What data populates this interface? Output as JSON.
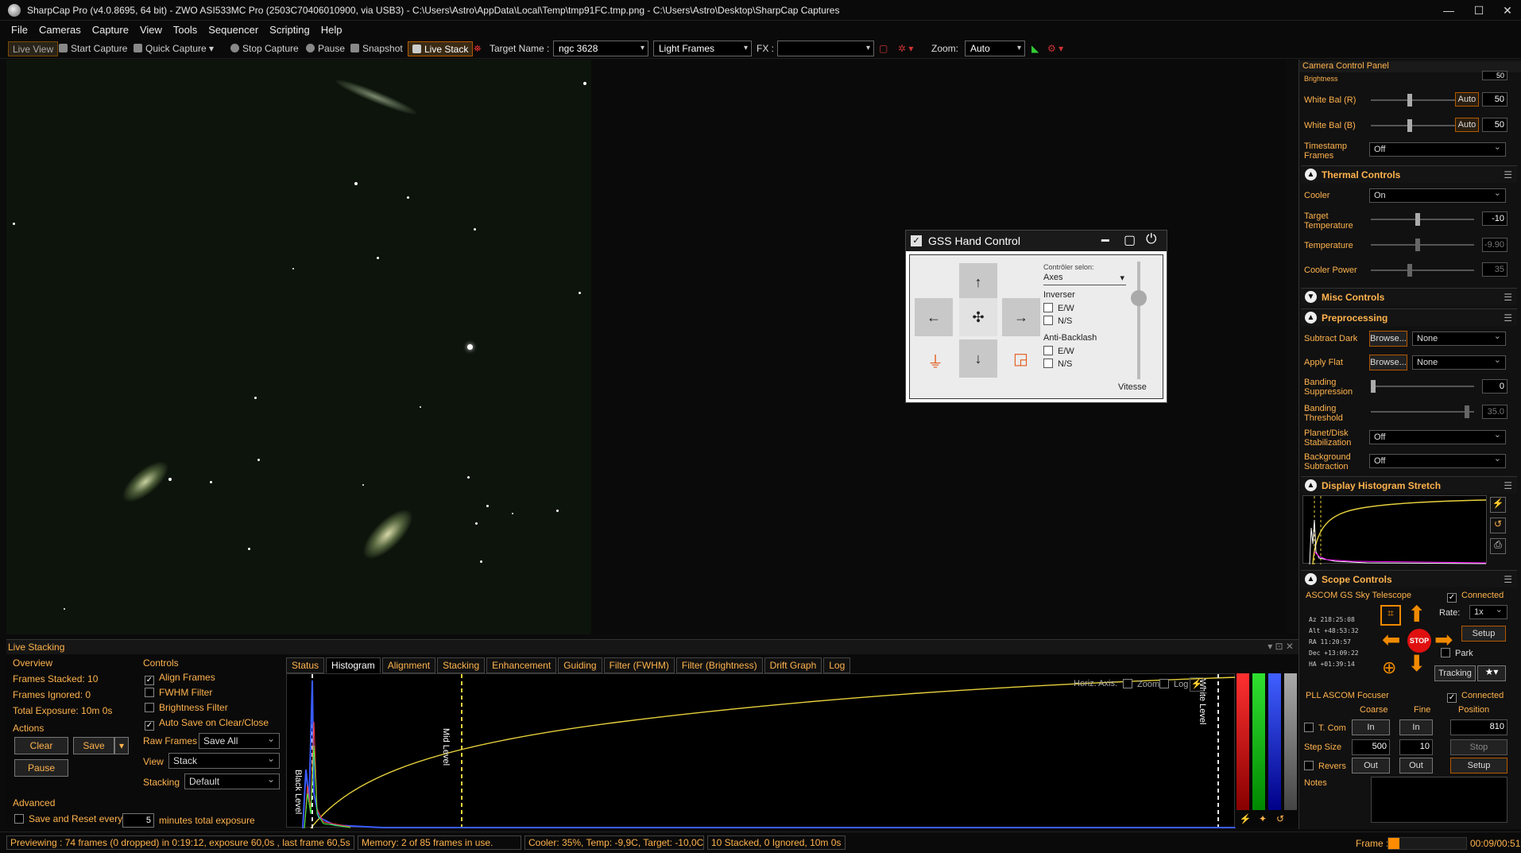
{
  "window": {
    "title": "SharpCap Pro (v4.0.8695, 64 bit) - ZWO ASI533MC Pro (2503C70406010900, via USB3) - C:\\Users\\Astro\\AppData\\Local\\Temp\\tmp91FC.tmp.png - C:\\Users\\Astro\\Desktop\\SharpCap Captures",
    "minimize": "—",
    "maximize": "☐",
    "close": "✕"
  },
  "menu": [
    "File",
    "Cameras",
    "Capture",
    "View",
    "Tools",
    "Sequencer",
    "Scripting",
    "Help"
  ],
  "toolbar": {
    "live_view": "Live View",
    "start_capture": "Start Capture",
    "quick_capture": "Quick Capture",
    "stop_capture": "Stop Capture",
    "pause": "Pause",
    "snapshot": "Snapshot",
    "live_stack": "Live Stack",
    "target_label": "Target Name :",
    "target_value": "ngc 3628",
    "frame_type": "Light Frames",
    "fx_label": "FX :",
    "fx_value": "",
    "zoom_label": "Zoom:",
    "zoom_value": "Auto"
  },
  "gss": {
    "title": "GSS Hand Control",
    "controller_label": "Contrôler selon:",
    "controller_value": "Axes",
    "invert_label": "Inverser",
    "ew": "E/W",
    "ns": "N/S",
    "backlash_label": "Anti-Backlash",
    "ew2": "E/W",
    "ns2": "N/S",
    "speed": "Vitesse",
    "up": "↑",
    "down": "↓",
    "left": "←",
    "right": "→",
    "center": "✣"
  },
  "camera_panel": {
    "title": "Camera Control Panel",
    "brightness_label": "Brightness",
    "brightness_value": "50",
    "wb_r_label": "White Bal (R)",
    "wb_r_auto": "Auto",
    "wb_r_value": "50",
    "wb_b_label": "White Bal (B)",
    "wb_b_auto": "Auto",
    "wb_b_value": "50",
    "timestamp_label": "Timestamp Frames",
    "timestamp_value": "Off",
    "thermal_title": "Thermal Controls",
    "cooler_label": "Cooler",
    "cooler_value": "On",
    "target_temp_label": "Target Temperature",
    "target_temp_value": "-10",
    "temp_label": "Temperature",
    "temp_value": "-9.90",
    "cooler_power_label": "Cooler Power",
    "cooler_power_value": "35",
    "misc_title": "Misc Controls",
    "pre_title": "Preprocessing",
    "subtract_dark_label": "Subtract Dark",
    "browse1": "Browse...",
    "dark_value": "None",
    "apply_flat_label": "Apply Flat",
    "browse2": "Browse...",
    "flat_value": "None",
    "banding_sup_label": "Banding Suppression",
    "banding_sup_value": "0",
    "banding_thr_label": "Banding Threshold",
    "banding_thr_value": "35.0",
    "planet_label": "Planet/Disk Stabilization",
    "planet_value": "Off",
    "bg_label": "Background Subtraction",
    "bg_value": "Off",
    "hist_title": "Display Histogram Stretch",
    "scope_title": "Scope Controls",
    "scope_name": "ASCOM GS Sky Telescope",
    "connected1": "Connected",
    "coords": [
      "Az   218:25:08",
      "Alt  +48:53:32",
      "RA    11:20:57",
      "Dec  +13:09:22",
      "HA   +01:39:14"
    ],
    "rate_label": "Rate:",
    "rate_value": "1x",
    "setup1": "Setup",
    "park": "Park",
    "tracking": "Tracking",
    "stop": "STOP",
    "focuser_name": "PLL ASCOM Focuser",
    "connected2": "Connected",
    "coarse": "Coarse",
    "fine": "Fine",
    "position": "Position",
    "tcomp": "T. Com",
    "in1": "In",
    "in2": "In",
    "pos_value": "810",
    "step_label": "Step Size",
    "step_coarse": "500",
    "step_fine": "10",
    "stop_btn": "Stop",
    "reverse": "Revers",
    "out1": "Out",
    "out2": "Out",
    "setup2": "Setup",
    "notes_label": "Notes"
  },
  "livestack": {
    "title": "Live Stacking",
    "overview": "Overview",
    "frames_stacked": "Frames Stacked:  10",
    "frames_ignored": "Frames Ignored:  0",
    "total_exposure": "Total Exposure:   10m 0s",
    "actions": "Actions",
    "clear": "Clear",
    "save": "Save",
    "pause": "Pause",
    "controls": "Controls",
    "align": "Align Frames",
    "fwhm": "FWHM Filter",
    "brightness": "Brightness Filter",
    "autosave": "Auto Save on Clear/Close",
    "raw_frames_label": "Raw Frames",
    "raw_frames_value": "Save All",
    "view_label": "View",
    "view_value": "Stack",
    "stacking_label": "Stacking",
    "stacking_value": "Default",
    "advanced": "Advanced",
    "save_reset": "Save and Reset every",
    "save_reset_value": "5",
    "minutes": "minutes total exposure",
    "tabs": [
      "Status",
      "Histogram",
      "Alignment",
      "Stacking",
      "Enhancement",
      "Guiding",
      "Filter (FWHM)",
      "Filter (Brightness)",
      "Drift Graph",
      "Log"
    ],
    "horiz_axis": "Horiz. Axis:",
    "zoom": "Zoom",
    "log": "Log",
    "black_level": "Black Level",
    "mid_level": "Mid Level",
    "white_level": "White Level"
  },
  "status": {
    "preview": "Previewing : 74 frames (0 dropped) in 0:19:12, exposure 60,0s , last frame 60,5s",
    "memory": "Memory: 2 of 85 frames in use.",
    "cooler": "Cooler: 35%, Temp: -9,9C, Target: -10,0C",
    "stacked": "10 Stacked, 0 Ignored, 10m 0s",
    "frame_label": "Frame :",
    "time": "00:09/00:51"
  }
}
